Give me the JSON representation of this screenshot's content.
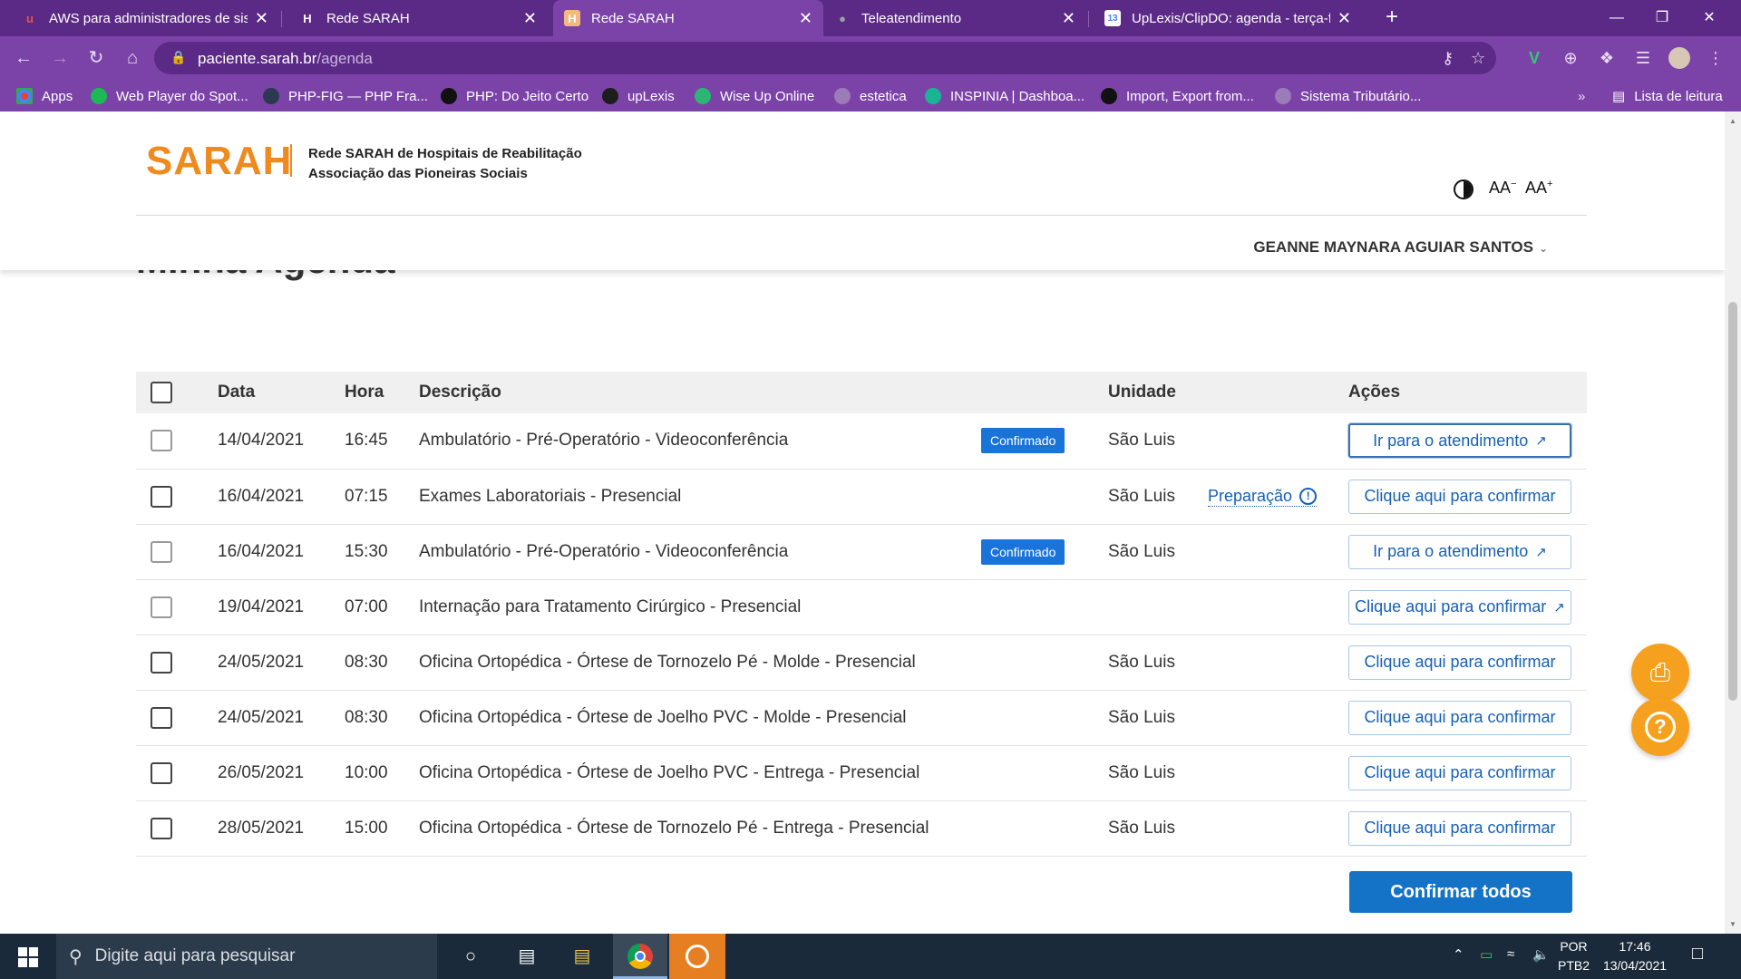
{
  "browser": {
    "tabs": [
      {
        "title": "AWS para administradores de sis",
        "icon": "udemy-icon"
      },
      {
        "title": "Rede SARAH",
        "icon": "sarah-icon"
      },
      {
        "title": "Rede SARAH",
        "icon": "sarah-icon"
      },
      {
        "title": "Teleatendimento",
        "icon": "globe-icon"
      },
      {
        "title": "UpLexis/ClipDO: agenda - terça-f",
        "icon": "calendar-icon"
      }
    ],
    "url_host": "paciente.sarah.br",
    "url_path": "/agenda",
    "bookmarks": [
      {
        "label": "Apps",
        "color": "#f4b400"
      },
      {
        "label": "Web Player do Spot...",
        "color": "#1db954"
      },
      {
        "label": "PHP-FIG — PHP Fra...",
        "color": "#2b3a52"
      },
      {
        "label": "PHP: Do Jeito Certo",
        "color": "#111111"
      },
      {
        "label": "upLexis",
        "color": "#1d1d1d"
      },
      {
        "label": "Wise Up Online",
        "color": "#2bb673"
      },
      {
        "label": "estetica",
        "color": "#9b7bb8"
      },
      {
        "label": "INSPINIA | Dashboa...",
        "color": "#1ab394"
      },
      {
        "label": "Import, Export from...",
        "color": "#111111"
      },
      {
        "label": "Sistema Tributário...",
        "color": "#9b7bb8"
      }
    ],
    "reading_list": "Lista de leitura"
  },
  "header": {
    "logo_text": "SARAH",
    "org_line1": "Rede SARAH de Hospitais de Reabilitação",
    "org_line2": "Associação das Pioneiras Sociais",
    "font_small": "AA",
    "font_large": "AA",
    "user_name": "GEANNE MAYNARA AGUIAR SANTOS"
  },
  "page_title": "Minha Agenda",
  "table": {
    "headers": {
      "date": "Data",
      "time": "Hora",
      "description": "Descrição",
      "unit": "Unidade",
      "actions": "Ações"
    },
    "rows": [
      {
        "date": "14/04/2021",
        "time": "16:45",
        "description": "Ambulatório - Pré-Operatório - Videoconferência",
        "badge": "Confirmado",
        "unit": "São Luis",
        "prep": "",
        "action": "Ir para o atendimento",
        "external": true,
        "focused": true,
        "checkbox_style": "light"
      },
      {
        "date": "16/04/2021",
        "time": "07:15",
        "description": "Exames Laboratoriais - Presencial",
        "badge": "",
        "unit": "São Luis",
        "prep": "Preparação",
        "action": "Clique aqui para confirmar",
        "external": false,
        "focused": false,
        "checkbox_style": "dark"
      },
      {
        "date": "16/04/2021",
        "time": "15:30",
        "description": "Ambulatório - Pré-Operatório - Videoconferência",
        "badge": "Confirmado",
        "unit": "São Luis",
        "prep": "",
        "action": "Ir para o atendimento",
        "external": true,
        "focused": false,
        "checkbox_style": "light"
      },
      {
        "date": "19/04/2021",
        "time": "07:00",
        "description": "Internação para Tratamento Cirúrgico - Presencial",
        "badge": "",
        "unit": "",
        "prep": "",
        "action": "Clique aqui para confirmar",
        "external": true,
        "focused": false,
        "checkbox_style": "light"
      },
      {
        "date": "24/05/2021",
        "time": "08:30",
        "description": "Oficina Ortopédica - Órtese de Tornozelo Pé - Molde - Presencial",
        "badge": "",
        "unit": "São Luis",
        "prep": "",
        "action": "Clique aqui para confirmar",
        "external": false,
        "focused": false,
        "checkbox_style": "dark"
      },
      {
        "date": "24/05/2021",
        "time": "08:30",
        "description": "Oficina Ortopédica - Órtese de Joelho PVC - Molde - Presencial",
        "badge": "",
        "unit": "São Luis",
        "prep": "",
        "action": "Clique aqui para confirmar",
        "external": false,
        "focused": false,
        "checkbox_style": "dark"
      },
      {
        "date": "26/05/2021",
        "time": "10:00",
        "description": "Oficina Ortopédica - Órtese de Joelho PVC - Entrega - Presencial",
        "badge": "",
        "unit": "São Luis",
        "prep": "",
        "action": "Clique aqui para confirmar",
        "external": false,
        "focused": false,
        "checkbox_style": "dark"
      },
      {
        "date": "28/05/2021",
        "time": "15:00",
        "description": "Oficina Ortopédica - Órtese de Tornozelo Pé - Entrega - Presencial",
        "badge": "",
        "unit": "São Luis",
        "prep": "",
        "action": "Clique aqui para confirmar",
        "external": false,
        "focused": false,
        "checkbox_style": "dark"
      }
    ]
  },
  "confirm_all_label": "Confirmar todos",
  "colors": {
    "brand": "#ef8a1e",
    "primary": "#1573c7",
    "browser": "#7b43a8",
    "fab": "#f5a11f"
  },
  "taskbar": {
    "search_placeholder": "Digite aqui para pesquisar",
    "lang_line1": "POR",
    "lang_line2": "PTB2",
    "time": "17:46",
    "date": "13/04/2021"
  }
}
